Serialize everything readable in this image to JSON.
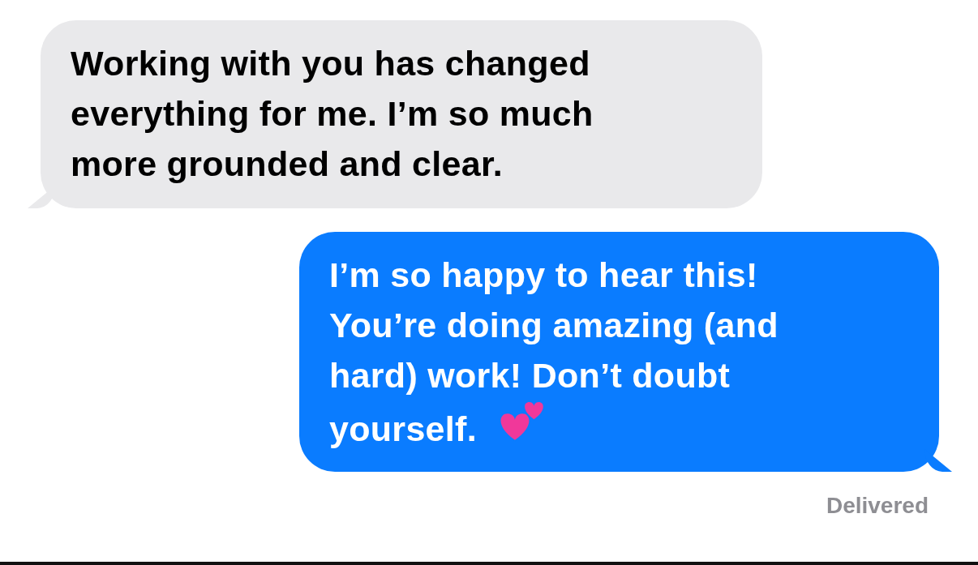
{
  "messages": [
    {
      "kind": "incoming",
      "text": "Working with you has changed\neverything for me. I’m so much\nmore grounded and clear."
    },
    {
      "kind": "outgoing",
      "text": "I’m so happy to hear this!\nYou’re doing amazing (and\nhard) work! Don’t doubt\nyourself.",
      "hearts": true
    }
  ],
  "status": "Delivered"
}
